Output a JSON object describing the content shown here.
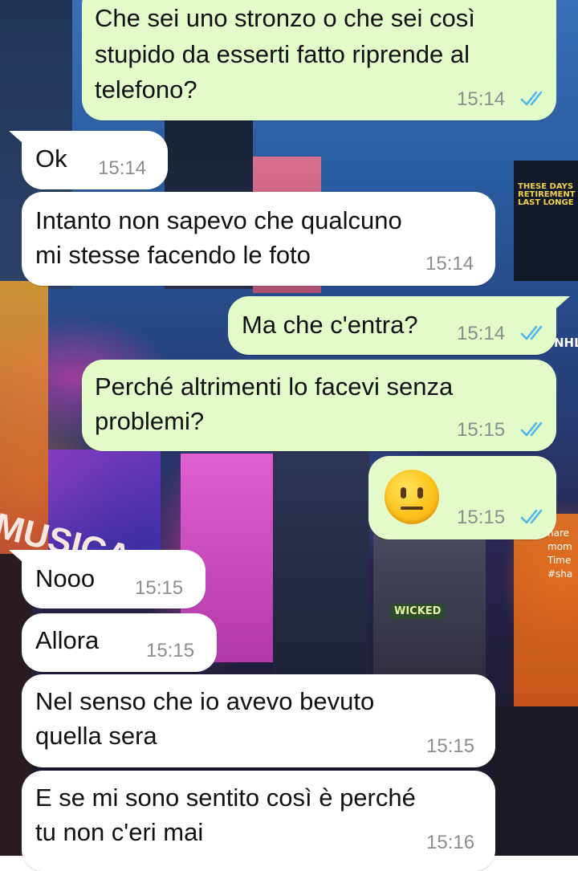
{
  "chat": {
    "messages": [
      {
        "direction": "outgoing",
        "text_lines": [
          "Che sei uno stronzo o che sei così",
          "stupido da esserti fatto riprende al",
          "telefono?"
        ],
        "time": "15:14",
        "status": "read"
      },
      {
        "direction": "incoming",
        "text_lines": [
          "Ok"
        ],
        "time": "15:14"
      },
      {
        "direction": "incoming",
        "text_lines": [
          "Intanto non sapevo che qualcuno",
          "mi stesse facendo le foto"
        ],
        "time": "15:14"
      },
      {
        "direction": "outgoing",
        "text_lines": [
          "Ma che c'entra?"
        ],
        "time": "15:14",
        "status": "read"
      },
      {
        "direction": "outgoing",
        "text_lines": [
          "Perché altrimenti lo facevi senza",
          "problemi?"
        ],
        "time": "15:15",
        "status": "read"
      },
      {
        "direction": "outgoing",
        "emoji": "neutral-face",
        "time": "15:15",
        "status": "read"
      },
      {
        "direction": "incoming",
        "text_lines": [
          "Nooo"
        ],
        "time": "15:15"
      },
      {
        "direction": "incoming",
        "text_lines": [
          "Allora"
        ],
        "time": "15:15"
      },
      {
        "direction": "incoming",
        "text_lines": [
          "Nel senso che io avevo bevuto",
          "quella sera"
        ],
        "time": "15:15"
      },
      {
        "direction": "incoming",
        "text_lines": [
          "E se mi sono sentito così è perché",
          "tu non c'eri mai"
        ],
        "time": "15:16"
      }
    ]
  },
  "wallpaper": {
    "signs": {
      "these_days": [
        "THESE DAYS",
        "RETIREMENT",
        "LAST LONGE"
      ],
      "nhl": "NHL",
      "musical": "MUSICA",
      "wicked": "WICKED",
      "share": [
        "hare",
        "mom",
        "Time",
        "#sha"
      ]
    }
  },
  "colors": {
    "incoming_bubble": "#ffffff",
    "outgoing_bubble": "#e2fbc9",
    "timestamp": "#8a8f8c",
    "read_ticks": "#4fb6ec"
  },
  "icons": {
    "read_status": "double-check-icon",
    "emoji": "neutral-face-icon"
  }
}
